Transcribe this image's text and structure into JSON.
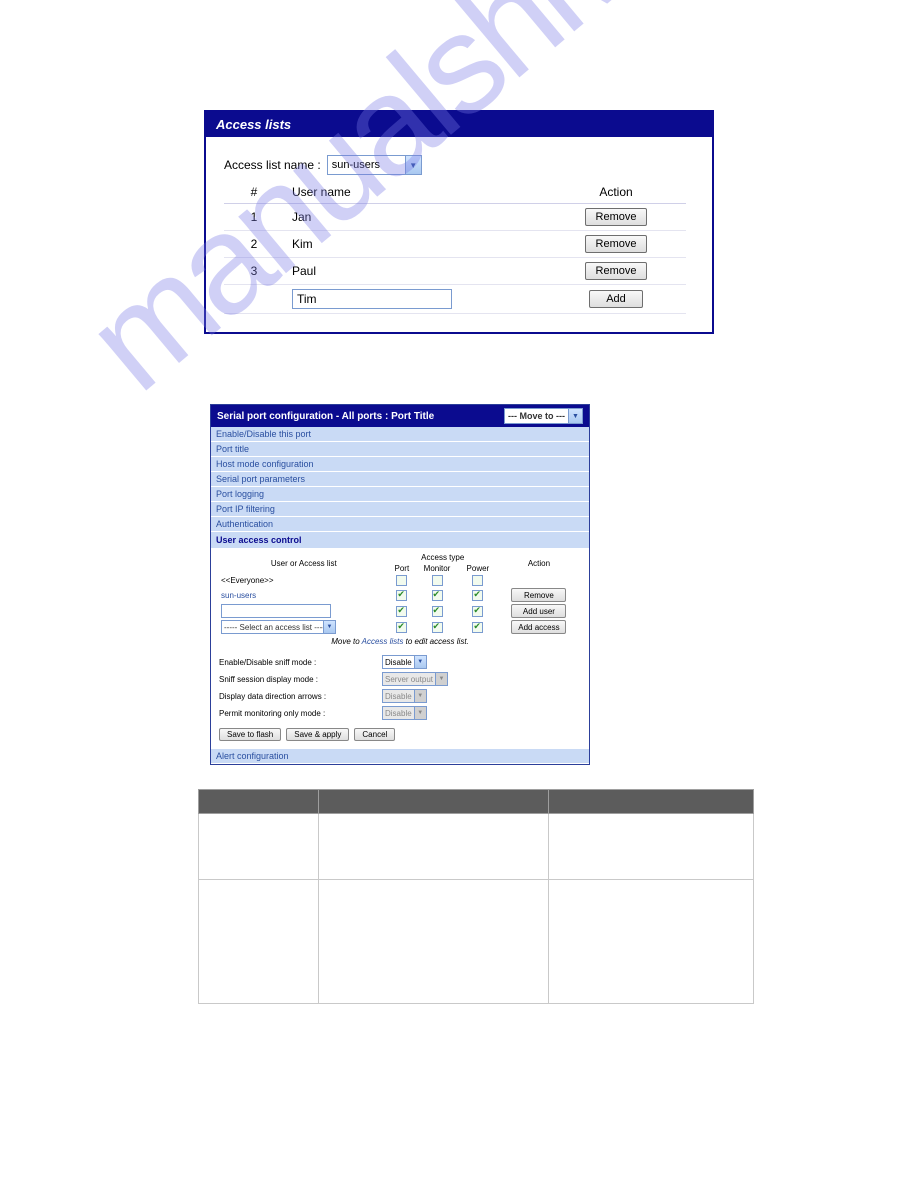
{
  "access_lists_panel": {
    "title": "Access lists",
    "label_access_list_name": "Access list name :",
    "selected_list": "sun-users",
    "col_num": "#",
    "col_user": "User name",
    "col_action": "Action",
    "rows": [
      {
        "num": "1",
        "name": "Jan"
      },
      {
        "num": "2",
        "name": "Kim"
      },
      {
        "num": "3",
        "name": "Paul"
      }
    ],
    "new_user_value": "Tim",
    "remove_label": "Remove",
    "add_label": "Add"
  },
  "serial_panel": {
    "title": "Serial port configuration - All ports : Port Title",
    "move_to": "--- Move to ---",
    "nav": [
      "Enable/Disable this port",
      "Port title",
      "Host mode configuration",
      "Serial port parameters",
      "Port logging",
      "Port IP filtering",
      "Authentication"
    ],
    "section": "User access control",
    "col_user_or_list": "User or Access list",
    "col_access_type": "Access type",
    "col_port": "Port",
    "col_monitor": "Monitor",
    "col_power": "Power",
    "col_action": "Action",
    "everyone": "<<Everyone>>",
    "sun_users": "sun-users",
    "remove": "Remove",
    "add_user": "Add user",
    "add_access": "Add access",
    "select_access_list": "----- Select an access list -----",
    "note_prefix": "Move to ",
    "note_link": "Access lists",
    "note_suffix": " to edit access list.",
    "sniff_mode_label": "Enable/Disable sniff mode :",
    "sniff_mode_value": "Disable",
    "display_mode_label": "Sniff session display mode :",
    "display_mode_value": "Server output",
    "arrows_label": "Display data direction arrows :",
    "arrows_value": "Disable",
    "permit_label": "Permit monitoring only mode :",
    "permit_value": "Disable",
    "save_to_flash": "Save to flash",
    "save_apply": "Save & apply",
    "cancel": "Cancel",
    "alert_config": "Alert configuration"
  }
}
